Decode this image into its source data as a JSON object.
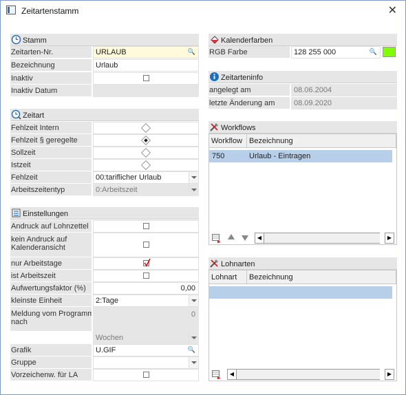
{
  "window": {
    "title": "Zeitartenstamm",
    "close": "✕"
  },
  "stamm": {
    "header": "Stamm",
    "rows": {
      "nr_label": "Zeitarten-Nr.",
      "nr_value": "URLAUB",
      "bez_label": "Bezeichnung",
      "bez_value": "Urlaub",
      "inaktiv_label": "Inaktiv",
      "inaktiv_datum_label": "Inaktiv Datum"
    }
  },
  "zeitart": {
    "header": "Zeitart",
    "fehlzeit_intern": "Fehlzeit Intern",
    "fehlzeit_geregelt": "Fehlzeit § geregelte",
    "sollzeit": "Sollzeit",
    "istzeit": "Istzeit",
    "fehlzeit_label": "Fehlzeit",
    "fehlzeit_value": "00:tariflicher Urlaub",
    "arbeitszeitentyp_label": "Arbeitszeitentyp",
    "arbeitszeitentyp_value": "0:Arbeitszeit"
  },
  "einstellungen": {
    "header": "Einstellungen",
    "andruck_lohnzettel": "Andruck auf Lohnzettel",
    "kein_andruck_line1": "kein Andruck auf",
    "kein_andruck_line2": "Kalenderansicht",
    "nur_arbeitstage": "nur Arbeitstage",
    "ist_arbeitszeit": "ist Arbeitszeit",
    "aufwertungsfaktor_label": "Aufwertungsfaktor (%)",
    "aufwertungsfaktor_value": "0,00",
    "kleinste_einheit_label": "kleinste Einheit",
    "kleinste_einheit_value": "2:Tage",
    "meldung_line1": "Meldung vom Programm",
    "meldung_line2": "nach",
    "meldung_value": "0",
    "wochen_value": "Wochen",
    "grafik_label": "Grafik",
    "grafik_value": "U.GIF",
    "gruppe_label": "Gruppe",
    "vorzeichen_label": "Vorzeichenw. für LA"
  },
  "kalenderfarben": {
    "header": "Kalenderfarben",
    "rgb_label": "RGB Farbe",
    "rgb_value": "128 255 000",
    "swatch_color": "#80ff00"
  },
  "zeitarteninfo": {
    "header": "Zeitarteninfo",
    "angelegt_label": "angelegt am",
    "angelegt_value": "08.06.2004",
    "aenderung_label": "letzte Änderung am",
    "aenderung_value": "08.09.2020"
  },
  "workflows": {
    "header": "Workflows",
    "columns": [
      "Workflow",
      "Bezeichnung"
    ],
    "rows": [
      {
        "workflow": "750",
        "bezeichnung": "Urlaub - Eintragen"
      }
    ]
  },
  "lohnarten": {
    "header": "Lohnarten",
    "columns": [
      "Lohnart",
      "Bezeichnung"
    ]
  },
  "colors": {
    "selection": "#b8cfe9",
    "label_bg": "#e6e6e6"
  }
}
